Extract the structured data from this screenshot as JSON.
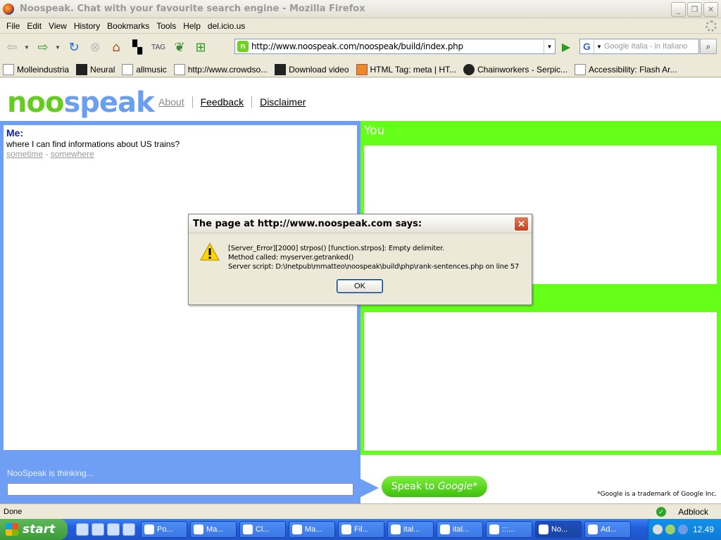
{
  "window": {
    "title": "Noospeak. Chat with your favourite search engine - Mozilla Firefox",
    "minimize": "_",
    "maximize": "❐",
    "close": "✕"
  },
  "menu": [
    "File",
    "Edit",
    "View",
    "History",
    "Bookmarks",
    "Tools",
    "Help",
    "del.icio.us"
  ],
  "navbar": {
    "url": "http://www.noospeak.com/noospeak/build/index.php",
    "search_engine": "G",
    "search_placeholder": "Google Italia - in Italiano"
  },
  "bookmarks": [
    {
      "label": "Molleindustria",
      "icon": "page-icon"
    },
    {
      "label": "Neural",
      "icon": "neural-icon"
    },
    {
      "label": "allmusic",
      "icon": "allmusic-icon"
    },
    {
      "label": "http://www.crowdso...",
      "icon": "page-icon"
    },
    {
      "label": "Download video",
      "icon": "film-icon"
    },
    {
      "label": "HTML Tag: meta | HT...",
      "icon": "fox-icon"
    },
    {
      "label": "Chainworkers - Serpic...",
      "icon": "avatar-icon"
    },
    {
      "label": "Accessibility: Flash Ar...",
      "icon": "page-icon"
    }
  ],
  "page": {
    "logo_noo": "noo",
    "logo_speak": "speak",
    "nav": {
      "about": "About",
      "feedback": "Feedback",
      "disclaimer": "Disclaimer"
    },
    "me": {
      "label": "Me:",
      "message": "where I can find informations about US trains?",
      "time": "sometime",
      "separator": " - ",
      "place": "somewhere"
    },
    "you": {
      "title": "You"
    },
    "thinking": "NooSpeak is thinking...",
    "speak_button_prefix": "Speak to ",
    "speak_button_brand": "Google",
    "speak_button_mark": "*",
    "trademark": "*Google is a trademark of Google Inc."
  },
  "dialog": {
    "title": "The page at http://www.noospeak.com says:",
    "line1": "[Server_Error][2000] strpos() [function.strpos]: Empty delimiter.",
    "line2": "Method called: myserver.getranked()",
    "line3": "Server script: D:\\Inetpub\\mmatteo\\noospeak\\build\\php\\rank-sentences.php on line 57",
    "ok": "OK",
    "close": "✕"
  },
  "status": {
    "text": "Done",
    "adblock": "Adblock"
  },
  "taskbar": {
    "start": "start",
    "tasks": [
      "Po...",
      "Ma...",
      "Cl...",
      "Ma...",
      "Fil...",
      "ital...",
      "ital...",
      ":::...",
      "No...",
      "Ad..."
    ],
    "active_index": 8,
    "clock": "12.49"
  },
  "colors": {
    "me_blue": "#6f9ff5",
    "you_green": "#66ff1a",
    "speak_green": "#3fbf0e"
  }
}
